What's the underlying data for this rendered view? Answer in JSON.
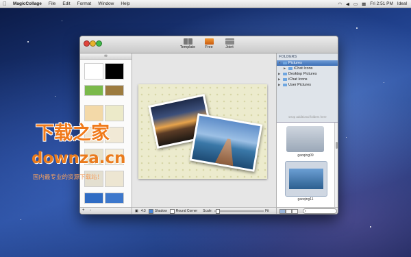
{
  "menubar": {
    "app_name": "MagicCollage",
    "items": [
      "File",
      "Edit",
      "Format",
      "Window",
      "Help"
    ],
    "clock": "Fri 2:51 PM",
    "user": "Ideal"
  },
  "toolbar": {
    "template_label": "Template",
    "free_label": "Free",
    "joint_label": "Joint"
  },
  "left_panel": {
    "header": "✉",
    "footer_add": "+",
    "footer_remove": "-"
  },
  "bottom_bar": {
    "ratio": "4:3",
    "shadow_label": "Shadow",
    "shadow_checked": true,
    "round_corner_label": "Round Corner",
    "round_corner_checked": false,
    "scale_label": "Scale:",
    "fit_label": "Fit"
  },
  "right_panel": {
    "folders_title": "FOLDERS",
    "folders": [
      {
        "name": "Pictures",
        "selected": true
      },
      {
        "name": "iChat Icons",
        "selected": false
      },
      {
        "name": "Desktop Pictures",
        "selected": false
      },
      {
        "name": "iChat Icons",
        "selected": false
      },
      {
        "name": "User Pictures",
        "selected": false
      }
    ],
    "drop_hint": "Drop additional folders here",
    "images": [
      "gaoqing09",
      "gaoqing11"
    ]
  },
  "watermark": {
    "line1": "下载之家",
    "line2": "downza.cn",
    "line3": "国内最专业的资源下载站！"
  }
}
